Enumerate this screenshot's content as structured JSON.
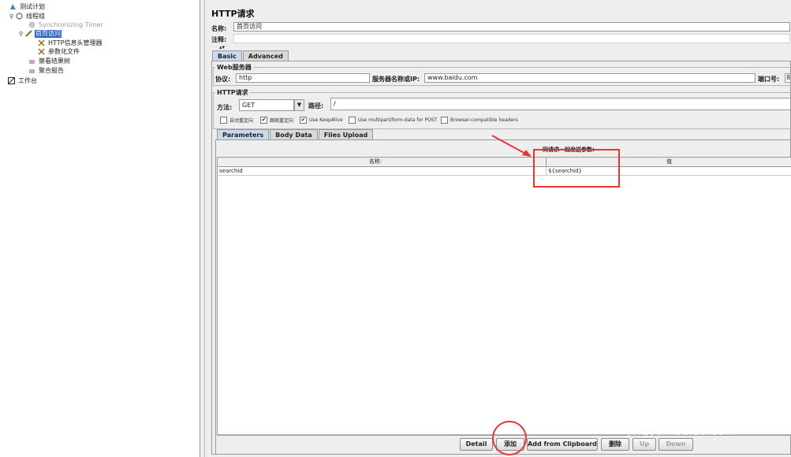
{
  "tree": {
    "nodes": [
      {
        "label": "测试计划"
      },
      {
        "label": "线程组"
      },
      {
        "label": "Synchronizing Timer"
      },
      {
        "label": "首页访问"
      },
      {
        "label": "HTTP信息头管理器"
      },
      {
        "label": "参数化文件"
      },
      {
        "label": "察看结果树"
      },
      {
        "label": "聚合报告"
      },
      {
        "label": "工作台"
      }
    ]
  },
  "panel": {
    "title": "HTTP请求",
    "name_label": "名称:",
    "name_value": "首页访问",
    "comment_label": "注释:",
    "tabs": [
      {
        "label": "Basic"
      },
      {
        "label": "Advanced"
      }
    ],
    "web_server_title": "Web服务器",
    "protocol_label": "协议:",
    "protocol_value": "http",
    "server_label": "服务器名称或IP:",
    "server_value": "www.baidu.com",
    "port_label": "端口号:",
    "port_value": "8",
    "http_request_title": "HTTP请求",
    "method_label": "方法:",
    "method_value": "GET",
    "path_label": "路径:",
    "path_value": "/",
    "checkboxes": [
      {
        "label": "自动重定向",
        "checked": false
      },
      {
        "label": "跟随重定向",
        "checked": true
      },
      {
        "label": "Use KeepAlive",
        "checked": true
      },
      {
        "label": "Use multipart/form-data for POST",
        "checked": false
      },
      {
        "label": "Browser-compatible headers",
        "checked": false
      }
    ],
    "subtabs": [
      {
        "label": "Parameters"
      },
      {
        "label": "Body Data"
      },
      {
        "label": "Files Upload"
      }
    ],
    "params_caption": "同请求一起发送参数:",
    "table": {
      "headers": [
        "名称:",
        "值"
      ],
      "rows": [
        [
          "searchid",
          "${searchid}"
        ]
      ]
    },
    "buttons": [
      {
        "label": "Detail"
      },
      {
        "label": "添加"
      },
      {
        "label": "Add from Clipboard"
      },
      {
        "label": "删除"
      },
      {
        "label": "Up"
      },
      {
        "label": "Down"
      }
    ]
  },
  "colors": {
    "accent": "#2f65ca",
    "annotation": "#e33333"
  }
}
